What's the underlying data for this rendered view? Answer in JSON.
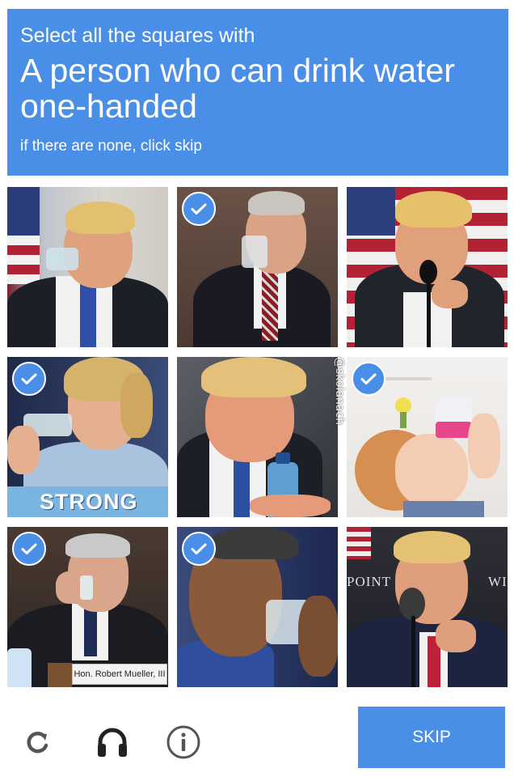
{
  "header": {
    "pre_text": "Select all the squares with",
    "main_text": "A person who can drink water one-handed",
    "sub_text": "if there are none, click skip",
    "background_color": "#4a8fe7"
  },
  "tiles": [
    {
      "row": 1,
      "col": 1,
      "selected": false
    },
    {
      "row": 1,
      "col": 2,
      "selected": true
    },
    {
      "row": 1,
      "col": 3,
      "selected": false
    },
    {
      "row": 2,
      "col": 1,
      "selected": true,
      "caption": "STRONG"
    },
    {
      "row": 2,
      "col": 2,
      "selected": false
    },
    {
      "row": 2,
      "col": 3,
      "selected": true
    },
    {
      "row": 3,
      "col": 1,
      "selected": true,
      "nameplate": "Hon. Robert Mueller, III"
    },
    {
      "row": 3,
      "col": 2,
      "selected": true
    },
    {
      "row": 3,
      "col": 3,
      "selected": false,
      "sign_left": "POINT",
      "sign_right": "WI"
    }
  ],
  "watermark": "@skolanach",
  "footer": {
    "icons": [
      "reload-icon",
      "headphones-icon",
      "info-icon"
    ],
    "skip_label": "SKIP"
  }
}
